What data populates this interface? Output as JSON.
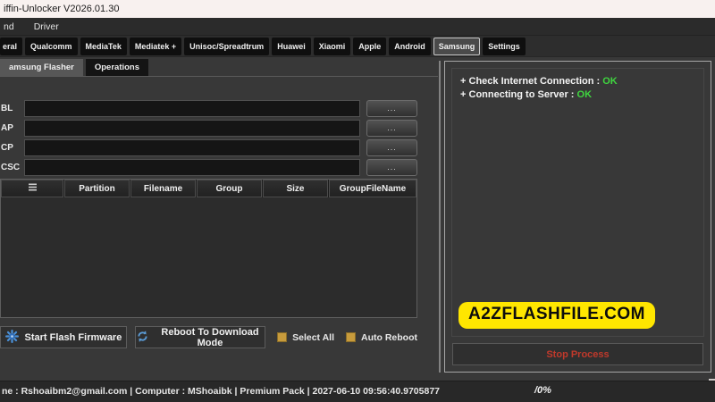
{
  "window": {
    "title": "iffin-Unlocker V2026.01.30",
    "menu": [
      "nd",
      "Driver"
    ]
  },
  "tabs": [
    {
      "label": "eral"
    },
    {
      "label": "Qualcomm"
    },
    {
      "label": "MediaTek"
    },
    {
      "label": "Mediatek +"
    },
    {
      "label": "Unisoc/Spreadtrum"
    },
    {
      "label": "Huawei"
    },
    {
      "label": "Xiaomi"
    },
    {
      "label": "Apple"
    },
    {
      "label": "Android"
    },
    {
      "label": "Samsung",
      "selected": true
    },
    {
      "label": "Settings"
    }
  ],
  "subtabs": [
    {
      "label": "amsung Flasher",
      "selected": true
    },
    {
      "label": "Operations"
    }
  ],
  "flasher": {
    "fields": [
      {
        "label": "BL",
        "value": "",
        "browse": "..."
      },
      {
        "label": "AP",
        "value": "",
        "browse": "..."
      },
      {
        "label": "CP",
        "value": "",
        "browse": "..."
      },
      {
        "label": "CSC",
        "value": "",
        "browse": "..."
      }
    ],
    "table_columns": [
      "Partition",
      "Filename",
      "Group",
      "Size",
      "GroupFileName"
    ],
    "start_button": "Start Flash Firmware",
    "reboot_button": "Reboot To Download Mode",
    "select_all_label": "Select All",
    "auto_reboot_label": "Auto Reboot"
  },
  "log": {
    "bullet": "+",
    "lines": [
      {
        "text": "Check Internet Connection :",
        "status": "OK"
      },
      {
        "text": "Connecting to Server :",
        "status": "OK"
      }
    ],
    "watermark": "A2ZFLASHFILE.COM",
    "stop_button": "Stop Process"
  },
  "statusbar": {
    "info": "ne : Rshoaibm2@gmail.com | Computer : MShoaibk | Premium Pack | 2027-06-10 09:56:40.9705877",
    "progress": "/0%"
  },
  "colors": {
    "ok_green": "#3fd63f",
    "stop_red": "#c0392b",
    "accent_blue": "#5b9bd5",
    "checkbox_amber": "#c79b3c",
    "watermark_yellow": "#ffe600"
  }
}
